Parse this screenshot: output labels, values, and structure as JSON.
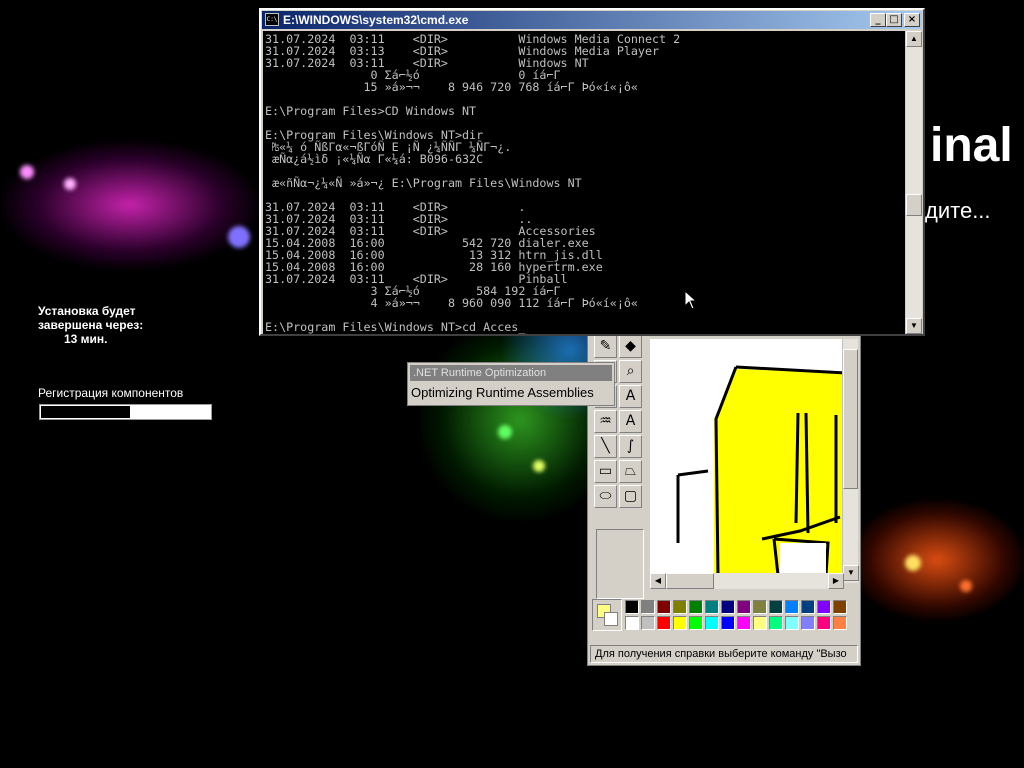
{
  "background": {
    "title_fragment": "inal",
    "subtitle_fragment": "дите..."
  },
  "setup": {
    "time_line1": "Установка будет",
    "time_line2": "завершена через:",
    "minutes": "13 мин.",
    "stage_label": "Регистрация компонентов",
    "progress_fraction": 0.52
  },
  "cmd": {
    "title": "E:\\WINDOWS\\system32\\cmd.exe",
    "icon_text": "C:\\",
    "minimize": "_",
    "maximize": "□",
    "close": "×",
    "lines": [
      "31.07.2024  03:11    <DIR>          Windows Media Connect 2",
      "31.07.2024  03:13    <DIR>          Windows Media Player",
      "31.07.2024  03:11    <DIR>          Windows NT",
      "               0 Σá⌐½ó              0 íá⌐Γ",
      "              15 »á»¬¬    8 946 720 768 íá⌐Γ Þó«í«¡ô«",
      "",
      "E:\\Program Files>CD Windows NT",
      "",
      "E:\\Program Files\\Windows NT>dir",
      " ₧«¼ ó ÑßΓα«¬ßΓóÑ E ¡Ñ ¿¼ÑÑΓ ¼ÑΓ¬¿.",
      " æÑα¿á½ìδ ¡«¼Ñα Γ«¼á: B096-632C",
      "",
      " æ«ñÑα¬¿¼«Ñ »á»¬¿ E:\\Program Files\\Windows NT",
      "",
      "31.07.2024  03:11    <DIR>          .",
      "31.07.2024  03:11    <DIR>          ..",
      "31.07.2024  03:11    <DIR>          Accessories",
      "15.04.2008  16:00           542 720 dialer.exe",
      "15.04.2008  16:00            13 312 htrn_jis.dll",
      "15.04.2008  16:00            28 160 hypertrm.exe",
      "31.07.2024  03:11    <DIR>          Pinball",
      "               3 Σá⌐½ó        584 192 íá⌐Γ",
      "               4 »á»¬¬    8 960 090 112 íá⌐Γ Þó«í«¡ô«",
      "",
      "E:\\Program Files\\Windows NT>cd Acces_"
    ]
  },
  "tooltip": {
    "title": ".NET Runtime Optimization",
    "text": "Optimizing Runtime Assemblies"
  },
  "paint": {
    "status": "Для получения справки выберите команду \"Вызо",
    "tools": [
      "pencil-icon",
      "fill-icon",
      "pencil-tool-icon",
      "magnifier-icon",
      "brush-icon",
      "text-icon",
      "airbrush-icon",
      "letter-a-icon",
      "line-icon",
      "curve-icon",
      "rectangle-icon",
      "polygon-icon",
      "ellipse-icon",
      "rounded-rect-icon"
    ],
    "palette_top": [
      "#000000",
      "#808080",
      "#800000",
      "#808000",
      "#008000",
      "#008080",
      "#000080",
      "#800080",
      "#808040",
      "#004040",
      "#0080ff",
      "#004080",
      "#8000ff",
      "#804000"
    ],
    "palette_bottom": [
      "#ffffff",
      "#c0c0c0",
      "#ff0000",
      "#ffff00",
      "#00ff00",
      "#00ffff",
      "#0000ff",
      "#ff00ff",
      "#ffff80",
      "#00ff80",
      "#80ffff",
      "#8080ff",
      "#ff0080",
      "#ff8040"
    ],
    "drawing_fill": "#ffff00"
  }
}
